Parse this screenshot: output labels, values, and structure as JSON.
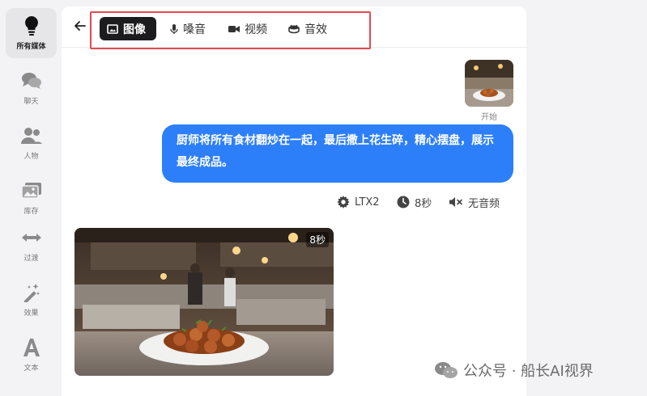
{
  "sidebar": {
    "items": [
      {
        "label": "所有媒体",
        "icon": "lightbulb-icon"
      },
      {
        "label": "聊天",
        "icon": "chat-bubbles-icon"
      },
      {
        "label": "人物",
        "icon": "people-icon"
      },
      {
        "label": "库存",
        "icon": "images-icon"
      },
      {
        "label": "过渡",
        "icon": "arrows-horizontal-icon"
      },
      {
        "label": "效果",
        "icon": "magic-wand-icon"
      },
      {
        "label": "文本",
        "icon": "letter-a-icon"
      }
    ]
  },
  "tabs": [
    {
      "label": "图像",
      "icon": "image-icon"
    },
    {
      "label": "嗓音",
      "icon": "microphone-icon"
    },
    {
      "label": "视频",
      "icon": "video-camera-icon"
    },
    {
      "label": "音效",
      "icon": "drum-icon"
    }
  ],
  "chat": {
    "thumb_label": "开始",
    "message": "厨师将所有食材翻炒在一起，最后撒上花生碎，精心摆盘，展示最终成品。",
    "meta": {
      "model": "LTX2",
      "duration": "8秒",
      "audio": "无音频"
    },
    "result_badge": "8秒"
  },
  "watermark": {
    "text": "公众号 · 船长AI视界"
  },
  "colors": {
    "accent": "#2d7ff9",
    "highlight_border": "#e24a52",
    "active_tab": "#1c1c1e"
  }
}
